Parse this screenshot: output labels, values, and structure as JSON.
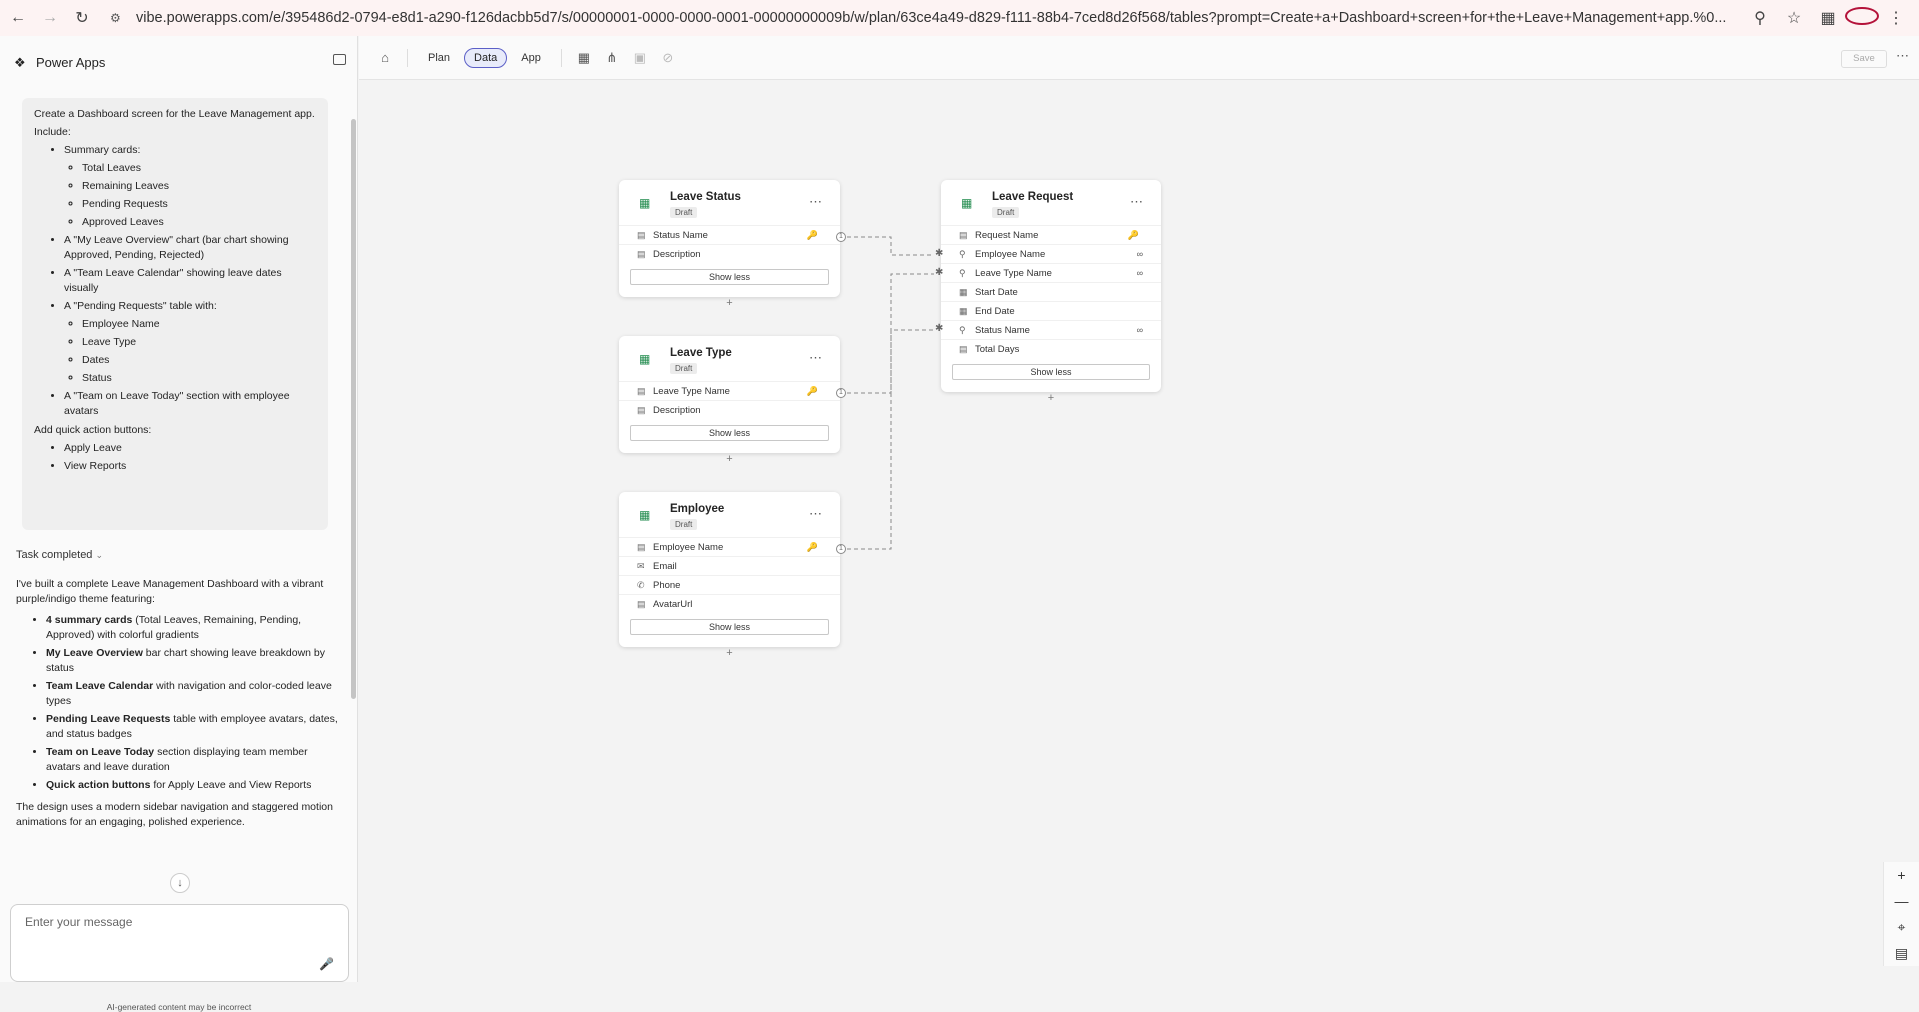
{
  "browser": {
    "url": "vibe.powerapps.com/e/395486d2-0794-e8d1-a290-f126dacbb5d7/s/00000001-0000-0000-0001-00000000009b/w/plan/63ce4a49-d829-f111-88b4-7ced8d26f568/tables?prompt=Create+a+Dashboard+screen+for+the+Leave+Management+app.%0..."
  },
  "app": {
    "name": "Power Apps"
  },
  "prompt": {
    "intro": "Create a Dashboard screen for the Leave Management app.",
    "include": "Include:",
    "items": [
      {
        "label": "Summary cards:",
        "sub": [
          "Total Leaves",
          "Remaining Leaves",
          "Pending Requests",
          "Approved Leaves"
        ]
      },
      {
        "label": "A \"My Leave Overview\" chart (bar chart showing Approved, Pending, Rejected)",
        "sub": []
      },
      {
        "label": "A \"Team Leave Calendar\" showing leave dates visually",
        "sub": []
      },
      {
        "label": "A \"Pending Requests\" table with:",
        "sub": [
          "Employee Name",
          "Leave Type",
          "Dates",
          "Status"
        ]
      },
      {
        "label": "A \"Team on Leave Today\" section with employee avatars",
        "sub": []
      }
    ],
    "quick_actions_label": "Add quick action buttons:",
    "quick_actions": [
      "Apply Leave",
      "View Reports"
    ]
  },
  "task_status": "Task completed",
  "response": {
    "intro": "I've built a complete Leave Management Dashboard with a vibrant purple/indigo theme featuring:",
    "items": [
      {
        "bold": "4 summary cards",
        "text": " (Total Leaves, Remaining, Pending, Approved) with colorful gradients"
      },
      {
        "bold": "My Leave Overview",
        "text": " bar chart showing leave breakdown by status"
      },
      {
        "bold": "Team Leave Calendar",
        "text": " with navigation and color-coded leave types"
      },
      {
        "bold": "Pending Leave Requests",
        "text": " table with employee avatars, dates, and status badges"
      },
      {
        "bold": "Team on Leave Today",
        "text": " section displaying team member avatars and leave duration"
      },
      {
        "bold": "Quick action buttons",
        "text": " for Apply Leave and View Reports"
      }
    ],
    "outro": "The design uses a modern sidebar navigation and staggered motion animations for an engaging, polished experience."
  },
  "message": {
    "placeholder": "Enter your message"
  },
  "disclaimer": "AI-generated content may be incorrect",
  "toolbar": {
    "tabs": [
      "Plan",
      "Data",
      "App"
    ],
    "active_tab": "Data",
    "save_label": "Save"
  },
  "tables": [
    {
      "title": "Leave Status",
      "badge": "Draft",
      "fields": [
        {
          "name": "Status Name",
          "icon": "text-field-icon",
          "key": true
        },
        {
          "name": "Description",
          "icon": "multiline-field-icon",
          "key": false
        }
      ],
      "button": "Show less"
    },
    {
      "title": "Leave Type",
      "badge": "Draft",
      "fields": [
        {
          "name": "Leave Type Name",
          "icon": "text-field-icon",
          "key": true
        },
        {
          "name": "Description",
          "icon": "multiline-field-icon",
          "key": false
        }
      ],
      "button": "Show less"
    },
    {
      "title": "Employee",
      "badge": "Draft",
      "fields": [
        {
          "name": "Employee Name",
          "icon": "text-field-icon",
          "key": true
        },
        {
          "name": "Email",
          "icon": "email-field-icon",
          "key": false
        },
        {
          "name": "Phone",
          "icon": "phone-field-icon",
          "key": false
        },
        {
          "name": "AvatarUrl",
          "icon": "multiline-field-icon",
          "key": false
        }
      ],
      "button": "Show less"
    },
    {
      "title": "Leave Request",
      "badge": "Draft",
      "fields": [
        {
          "name": "Request Name",
          "icon": "text-field-icon",
          "key": true
        },
        {
          "name": "Employee Name",
          "icon": "lookup-field-icon",
          "key": false,
          "lookup": true
        },
        {
          "name": "Leave Type Name",
          "icon": "lookup-field-icon",
          "key": false,
          "lookup": true
        },
        {
          "name": "Start Date",
          "icon": "date-field-icon",
          "key": false
        },
        {
          "name": "End Date",
          "icon": "date-field-icon",
          "key": false
        },
        {
          "name": "Status Name",
          "icon": "lookup-field-icon",
          "key": false,
          "lookup": true
        },
        {
          "name": "Total Days",
          "icon": "number-field-icon",
          "key": false
        }
      ],
      "button": "Show less"
    }
  ]
}
